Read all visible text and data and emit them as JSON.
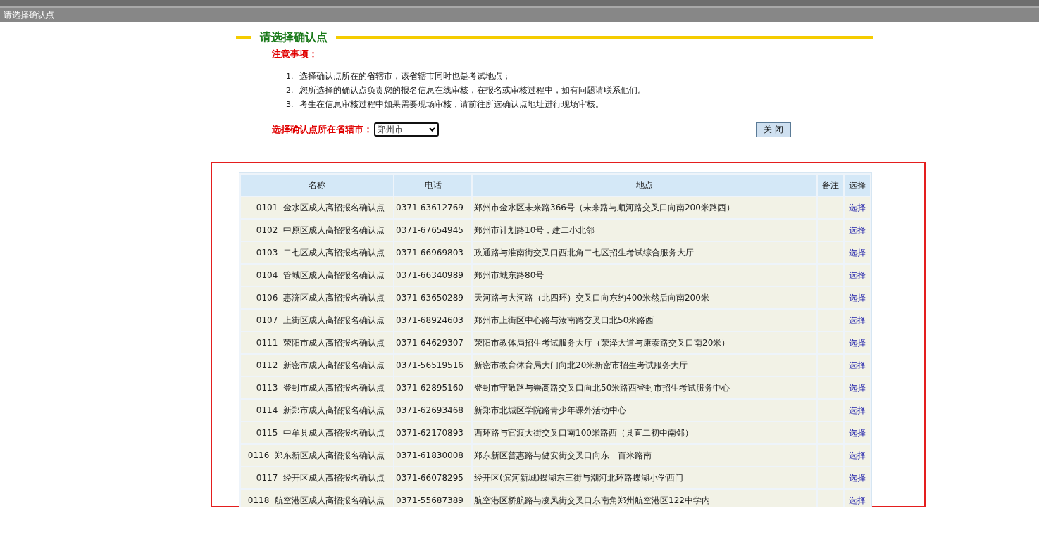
{
  "window": {
    "title": "请选择确认点"
  },
  "heading": "请选择确认点",
  "notice_title": "注意事项：",
  "notes": [
    {
      "number": "1.",
      "text": "选择确认点所在的省辖市，该省辖市同时也是考试地点；"
    },
    {
      "number": "2.",
      "text": "您所选择的确认点负责您的报名信息在线审核，在报名或审核过程中，如有问题请联系他们。"
    },
    {
      "number": "3.",
      "text": "考生在信息审核过程中如果需要现场审核，请前往所选确认点地址进行现场审核。"
    }
  ],
  "city_selector": {
    "label": "选择确认点所在省辖市：",
    "value": "郑州市"
  },
  "close_button": "关 闭",
  "table": {
    "columns": [
      "名称",
      "电话",
      "地点",
      "备注",
      "选择"
    ],
    "rows": [
      {
        "name": "0101  金水区成人高招报名确认点",
        "phone": "0371-63612769",
        "address": "郑州市金水区未来路366号（未来路与顺河路交叉口向南200米路西）",
        "action": "选择"
      },
      {
        "name": "0102  中原区成人高招报名确认点",
        "phone": "0371-67654945",
        "address": "郑州市计划路10号，建二小北邻",
        "action": "选择"
      },
      {
        "name": "0103  二七区成人高招报名确认点",
        "phone": "0371-66969803",
        "address": "政通路与淮南街交叉口西北角二七区招生考试综合服务大厅",
        "action": "选择"
      },
      {
        "name": "0104  管城区成人高招报名确认点",
        "phone": "0371-66340989",
        "address": "郑州市城东路80号",
        "action": "选择"
      },
      {
        "name": "0106  惠济区成人高招报名确认点",
        "phone": "0371-63650289",
        "address": "天河路与大河路（北四环）交叉口向东约400米然后向南200米",
        "action": "选择"
      },
      {
        "name": "0107  上街区成人高招报名确认点",
        "phone": "0371-68924603",
        "address": "郑州市上街区中心路与汝南路交叉口北50米路西",
        "action": "选择"
      },
      {
        "name": "0111  荥阳市成人高招报名确认点",
        "phone": "0371-64629307",
        "address": "荥阳市教体局招生考试服务大厅（荥泽大道与康泰路交叉口南20米）",
        "action": "选择"
      },
      {
        "name": "0112  新密市成人高招报名确认点",
        "phone": "0371-56519516",
        "address": "新密市教育体育局大门向北20米新密市招生考试服务大厅",
        "action": "选择"
      },
      {
        "name": "0113  登封市成人高招报名确认点",
        "phone": "0371-62895160",
        "address": "登封市守敬路与崇高路交叉口向北50米路西登封市招生考试服务中心",
        "action": "选择"
      },
      {
        "name": "0114  新郑市成人高招报名确认点",
        "phone": "0371-62693468",
        "address": "新郑市北城区学院路青少年课外活动中心",
        "action": "选择"
      },
      {
        "name": "0115  中牟县成人高招报名确认点",
        "phone": "0371-62170893",
        "address": "西环路与官渡大街交叉口南100米路西（县直二初中南邻）",
        "action": "选择"
      },
      {
        "name": "0116  郑东新区成人高招报名确认点",
        "phone": "0371-61830008",
        "address": "郑东新区普惠路与健安街交叉口向东一百米路南",
        "action": "选择"
      },
      {
        "name": "0117  经开区成人高招报名确认点",
        "phone": "0371-66078295",
        "address": "经开区(滨河新城)蝶湖东三街与潮河北环路蝶湖小学西门",
        "action": "选择"
      },
      {
        "name": "0118  航空港区成人高招报名确认点",
        "phone": "0371-55687389",
        "address": "航空港区桥航路与凌风街交叉口东南角郑州航空港区122中学内",
        "action": "选择"
      }
    ]
  }
}
